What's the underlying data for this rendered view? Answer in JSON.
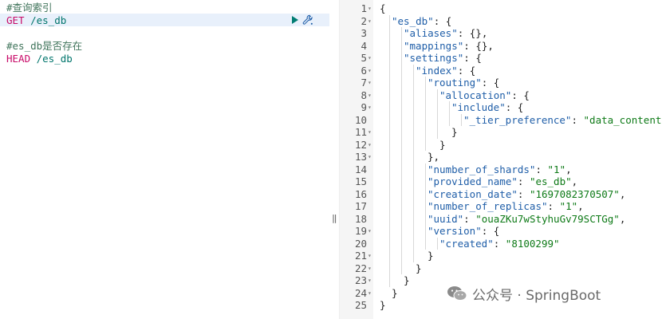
{
  "console": {
    "lines": [
      {
        "type": "comment",
        "text": "#查询索引"
      },
      {
        "type": "request",
        "method": "GET",
        "path": "/es_db"
      },
      {
        "type": "blank",
        "text": ""
      },
      {
        "type": "comment",
        "text": "#es_db是否存在"
      },
      {
        "type": "request",
        "method": "HEAD",
        "path": "/es_db"
      }
    ]
  },
  "response": {
    "rows": [
      {
        "n": "1",
        "fold": true,
        "indent": 0,
        "t": [
          [
            "p",
            "{"
          ]
        ]
      },
      {
        "n": "2",
        "fold": true,
        "indent": 1,
        "t": [
          [
            "k",
            "\"es_db\""
          ],
          [
            "p",
            ": {"
          ]
        ]
      },
      {
        "n": "3",
        "fold": false,
        "indent": 2,
        "t": [
          [
            "k",
            "\"aliases\""
          ],
          [
            "p",
            ": {},"
          ]
        ]
      },
      {
        "n": "4",
        "fold": false,
        "indent": 2,
        "t": [
          [
            "k",
            "\"mappings\""
          ],
          [
            "p",
            ": {},"
          ]
        ]
      },
      {
        "n": "5",
        "fold": true,
        "indent": 2,
        "t": [
          [
            "k",
            "\"settings\""
          ],
          [
            "p",
            ": {"
          ]
        ]
      },
      {
        "n": "6",
        "fold": true,
        "indent": 3,
        "t": [
          [
            "k",
            "\"index\""
          ],
          [
            "p",
            ": {"
          ]
        ]
      },
      {
        "n": "7",
        "fold": true,
        "indent": 4,
        "t": [
          [
            "k",
            "\"routing\""
          ],
          [
            "p",
            ": {"
          ]
        ]
      },
      {
        "n": "8",
        "fold": true,
        "indent": 5,
        "t": [
          [
            "k",
            "\"allocation\""
          ],
          [
            "p",
            ": {"
          ]
        ]
      },
      {
        "n": "9",
        "fold": true,
        "indent": 6,
        "t": [
          [
            "k",
            "\"include\""
          ],
          [
            "p",
            ": {"
          ]
        ]
      },
      {
        "n": "10",
        "fold": false,
        "indent": 7,
        "t": [
          [
            "k",
            "\"_tier_preference\""
          ],
          [
            "p",
            ": "
          ],
          [
            "s",
            "\"data_content\""
          ]
        ]
      },
      {
        "n": "11",
        "fold": true,
        "indent": 6,
        "t": [
          [
            "p",
            "}"
          ]
        ]
      },
      {
        "n": "12",
        "fold": true,
        "indent": 5,
        "t": [
          [
            "p",
            "}"
          ]
        ]
      },
      {
        "n": "13",
        "fold": true,
        "indent": 4,
        "t": [
          [
            "p",
            "},"
          ]
        ]
      },
      {
        "n": "14",
        "fold": false,
        "indent": 4,
        "t": [
          [
            "k",
            "\"number_of_shards\""
          ],
          [
            "p",
            ": "
          ],
          [
            "s",
            "\"1\""
          ],
          [
            "p",
            ","
          ]
        ]
      },
      {
        "n": "15",
        "fold": false,
        "indent": 4,
        "t": [
          [
            "k",
            "\"provided_name\""
          ],
          [
            "p",
            ": "
          ],
          [
            "s",
            "\"es_db\""
          ],
          [
            "p",
            ","
          ]
        ]
      },
      {
        "n": "16",
        "fold": false,
        "indent": 4,
        "t": [
          [
            "k",
            "\"creation_date\""
          ],
          [
            "p",
            ": "
          ],
          [
            "s",
            "\"1697082370507\""
          ],
          [
            "p",
            ","
          ]
        ]
      },
      {
        "n": "17",
        "fold": false,
        "indent": 4,
        "t": [
          [
            "k",
            "\"number_of_replicas\""
          ],
          [
            "p",
            ": "
          ],
          [
            "s",
            "\"1\""
          ],
          [
            "p",
            ","
          ]
        ]
      },
      {
        "n": "18",
        "fold": false,
        "indent": 4,
        "t": [
          [
            "k",
            "\"uuid\""
          ],
          [
            "p",
            ": "
          ],
          [
            "s",
            "\"ouaZKu7wStyhuGv79SCTGg\""
          ],
          [
            "p",
            ","
          ]
        ]
      },
      {
        "n": "19",
        "fold": true,
        "indent": 4,
        "t": [
          [
            "k",
            "\"version\""
          ],
          [
            "p",
            ": {"
          ]
        ]
      },
      {
        "n": "20",
        "fold": false,
        "indent": 5,
        "t": [
          [
            "k",
            "\"created\""
          ],
          [
            "p",
            ": "
          ],
          [
            "s",
            "\"8100299\""
          ]
        ]
      },
      {
        "n": "21",
        "fold": true,
        "indent": 4,
        "t": [
          [
            "p",
            "}"
          ]
        ]
      },
      {
        "n": "22",
        "fold": true,
        "indent": 3,
        "t": [
          [
            "p",
            "}"
          ]
        ]
      },
      {
        "n": "23",
        "fold": true,
        "indent": 2,
        "t": [
          [
            "p",
            "}"
          ]
        ]
      },
      {
        "n": "24",
        "fold": true,
        "indent": 1,
        "t": [
          [
            "p",
            "}"
          ]
        ]
      },
      {
        "n": "25",
        "fold": false,
        "indent": 0,
        "t": [
          [
            "p",
            "}"
          ]
        ]
      }
    ]
  },
  "watermark": {
    "text": "公众号 · SpringBoot"
  },
  "colors": {
    "comment": "#41755c",
    "method": "#c80a68",
    "path": "#00756c",
    "key": "#1f5ea8",
    "string": "#0e7a17",
    "run": "#017d73"
  },
  "icons": {
    "run": "play-icon",
    "settings": "wrench-icon",
    "resize": "resize-grip-icon",
    "watermark": "wechat-icon"
  }
}
